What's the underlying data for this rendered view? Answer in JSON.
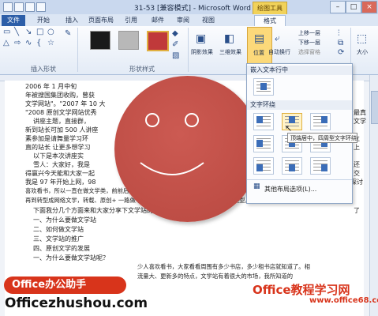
{
  "window": {
    "title": "31-53 [兼容模式] - Microsoft Word",
    "context_tab_group": "绘图工具"
  },
  "tabs": [
    "文件",
    "开始",
    "插入",
    "页面布局",
    "引用",
    "邮件",
    "审阅",
    "视图",
    "格式"
  ],
  "ribbon": {
    "groups": {
      "insert_shapes": "插入形状",
      "shape_styles": "形状样式",
      "size": "大小"
    },
    "buttons": {
      "shadow_effects": "阴影效果",
      "three_d_effects": "三维效果",
      "position": "位置",
      "auto_wrap": "自动换行",
      "bring_forward": "上移一层",
      "send_backward": "下移一层",
      "selection_pane": "选择窗格",
      "size": "大小"
    },
    "swatch_colors": [
      "#1a1a1a",
      "#b8b8b8",
      "#c0393a"
    ]
  },
  "position_menu": {
    "inline_header": "嵌入文本行中",
    "wrap_header": "文字环绕",
    "more_options": "其他布局选项(L)...",
    "tooltip": "顶端居中，四周型文字环绕"
  },
  "document": {
    "lines": [
      "2006 年 1 月中旬",
      "年被搜国集团收购，曾获",
      "文学网站\"。\"2007 年 10 大",
      "\"2008 原创文学网站优秀",
      "讲座主题，直接群，",
      "新到站长可加 500 人讲座",
      "素参加是请舞量学习环",
      "直的站长 让更多想学习",
      "以下是本次讲座实",
      "雪人：大家好，我是",
      "得赢兴今天能和大家一起",
      "我是 97 年开始上网，98",
      "喜欢看书，所以一直在做文学类，前前后后也有超过十年了。从一开始的传统文学，",
      "再到转型成网络文学，转载、原创+ 一路做下来，感觉文学站还是很有潜力的站点类型。",
      "下面我分几个方面来和大家分享下文学站的运作：",
      "一、为什么要做文学站",
      "二、如何做文学站",
      "三、文学站的推广",
      "四、原创文学的发展",
      "一、为什么要做文学站呢？",
      "少人喜欢看书，大家看看周围有多少书店，多少租书店就知道了。相",
      "流量大、更新多的特点，文学站有着很大的市场，我所知道的"
    ],
    "right_fragments": [
      "最真",
      "文学",
      "立",
      "上",
      "还",
      "交",
      "探讨",
      "了"
    ]
  },
  "watermarks": {
    "badge": "Office办公助手",
    "url": "Officezhushou.com",
    "brand": "Office教程学习网",
    "brand_url": "www.office68.com"
  }
}
